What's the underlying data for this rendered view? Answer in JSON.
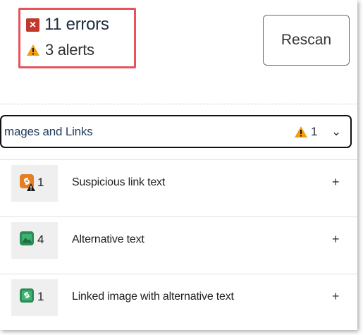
{
  "summary": {
    "errors_label": "11 errors",
    "alerts_label": "3 alerts",
    "error_icon": "error-x-icon",
    "alert_icon": "warning-triangle-icon"
  },
  "rescan_button": {
    "label": "Rescan"
  },
  "section": {
    "title": "mages and Links",
    "alert_count": "1",
    "expanded": true
  },
  "checks": [
    {
      "count": "1",
      "label": "Suspicious link text",
      "icon": "suspicious-link-icon",
      "action": "+"
    },
    {
      "count": "4",
      "label": "Alternative text",
      "icon": "image-icon",
      "action": "+"
    },
    {
      "count": "1",
      "label": "Linked image with alternative text",
      "icon": "linked-image-icon",
      "action": "+"
    }
  ],
  "colors": {
    "error": "#c0392b",
    "alert": "#f39c12",
    "highlight_border": "#e5545d",
    "link_icon": "#e67e22",
    "image_icon": "#2e8b57"
  }
}
